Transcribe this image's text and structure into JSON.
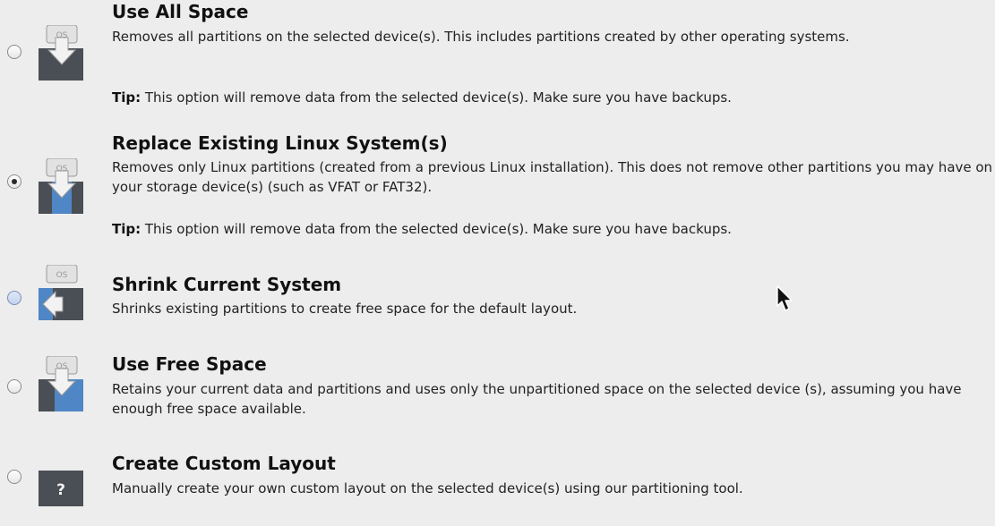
{
  "options": [
    {
      "title": "Use All Space",
      "description": "Removes all partitions on the selected device(s).  This includes partitions created by other operating systems.",
      "tip_label": "Tip:",
      "tip_text": " This option will remove data from the selected device(s).  Make sure you have backups.",
      "selected": false,
      "icon": "disk-wipe-icon"
    },
    {
      "title": "Replace Existing Linux System(s)",
      "description": "Removes only Linux partitions (created from a previous Linux installation).  This does not remove other partitions you may have on your storage device(s) (such as VFAT or FAT32).",
      "tip_label": "Tip:",
      "tip_text": " This option will remove data from the selected device(s).  Make sure you have backups.",
      "selected": true,
      "icon": "disk-replace-linux-icon"
    },
    {
      "title": "Shrink Current System",
      "description": "Shrinks existing partitions to create free space for the default layout.",
      "selected": false,
      "icon": "disk-shrink-icon"
    },
    {
      "title": "Use Free Space",
      "description": "Retains your current data and partitions and uses only the unpartitioned space on the selected device (s), assuming you have enough free space available.",
      "selected": false,
      "icon": "disk-free-space-icon"
    },
    {
      "title": "Create Custom Layout",
      "description": "Manually create your own custom layout on the selected device(s) using our partitioning tool.",
      "selected": false,
      "icon": "custom-layout-icon"
    }
  ],
  "icon_text": {
    "os": "OS",
    "custom": "?"
  },
  "colors": {
    "background": "#ededed",
    "disk_dark": "#4a4e55",
    "disk_blue": "#4f86c6",
    "os_box": "#e2e2e2",
    "arrow": "#f2f2f2",
    "radio_hover": "#c3d3ee"
  }
}
